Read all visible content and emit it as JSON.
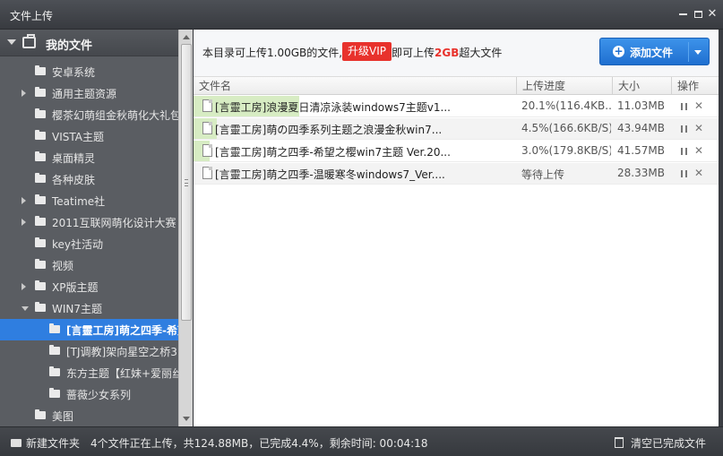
{
  "window": {
    "title": "文件上传",
    "minimize_icon": "minimize-icon",
    "maximize_icon": "maximize-icon",
    "close_icon": "close-icon",
    "close_glyph": "✕"
  },
  "sidebar": {
    "root_label": "我的文件",
    "root_icon": "briefcase-icon",
    "items": [
      {
        "label": "安卓系统",
        "level": 1,
        "expander": "none"
      },
      {
        "label": "通用主题资源",
        "level": 1,
        "expander": "collapsed"
      },
      {
        "label": "樱茶幻萌组金秋萌化大礼包",
        "level": 1,
        "expander": "none"
      },
      {
        "label": "VISTA主题",
        "level": 1,
        "expander": "none"
      },
      {
        "label": "桌面精灵",
        "level": 1,
        "expander": "none"
      },
      {
        "label": "各种皮肤",
        "level": 1,
        "expander": "none"
      },
      {
        "label": "Teatime社",
        "level": 1,
        "expander": "collapsed"
      },
      {
        "label": "2011互联网萌化设计大赛",
        "level": 1,
        "expander": "collapsed"
      },
      {
        "label": "key社活动",
        "level": 1,
        "expander": "none"
      },
      {
        "label": "视频",
        "level": 1,
        "expander": "none"
      },
      {
        "label": "XP版主题",
        "level": 1,
        "expander": "collapsed"
      },
      {
        "label": "WIN7主题",
        "level": 1,
        "expander": "expanded"
      },
      {
        "label": "[言靈工房]萌之四季-希望",
        "level": 2,
        "expander": "none",
        "selected": true
      },
      {
        "label": "[TJ调教]架向星空之桥3",
        "level": 2,
        "expander": "none"
      },
      {
        "label": "东方主题【红妹+爱丽丝",
        "level": 2,
        "expander": "none"
      },
      {
        "label": "蔷薇少女系列",
        "level": 2,
        "expander": "none"
      },
      {
        "label": "美图",
        "level": 1,
        "expander": "none"
      }
    ]
  },
  "infobar": {
    "prefix": "本目录可上传1.00GB的文件,",
    "vip_button": "升级VIP",
    "suffix_before": "即可上传",
    "suffix_highlight": "2GB",
    "suffix_after": "超大文件",
    "add_button": "添加文件",
    "add_icon": "plus-circle-icon",
    "add_menu_icon": "caret-down-icon"
  },
  "table": {
    "columns": [
      "文件名",
      "上传进度",
      "大小",
      "操作"
    ],
    "rows": [
      {
        "name": "[言靈工房]浪漫夏日清凉泳装windows7主题v1...",
        "progress_text": "20.1%(116.4KB...",
        "progress": 0.201,
        "size": "11.03MB"
      },
      {
        "name": "[言靈工房]萌の四季系列主题之浪漫金秋win7...",
        "progress_text": "4.5%(166.6KB/S)",
        "progress": 0.045,
        "size": "43.94MB"
      },
      {
        "name": "[言靈工房]萌之四季-希望之樱win7主题 Ver.20...",
        "progress_text": "3.0%(179.8KB/S)",
        "progress": 0.03,
        "size": "41.57MB"
      },
      {
        "name": "[言靈工房]萌之四季-温暖寒冬windows7_Ver....",
        "progress_text": "等待上传",
        "progress": 0,
        "size": "28.33MB"
      }
    ],
    "pause_icon": "pause-icon",
    "remove_icon": "close-icon",
    "remove_glyph": "✕"
  },
  "statusbar": {
    "new_folder": "新建文件夹",
    "new_folder_icon": "new-folder-icon",
    "status": "4个文件正在上传，共124.88MB，已完成4.4%，剩余时间: 00:04:18",
    "clear_button": "清空已完成文件",
    "clear_icon": "trash-icon"
  },
  "colors": {
    "accent": "#2f7ee0",
    "vip": "#e8322c",
    "progress_fill": "#d7ecc3"
  }
}
